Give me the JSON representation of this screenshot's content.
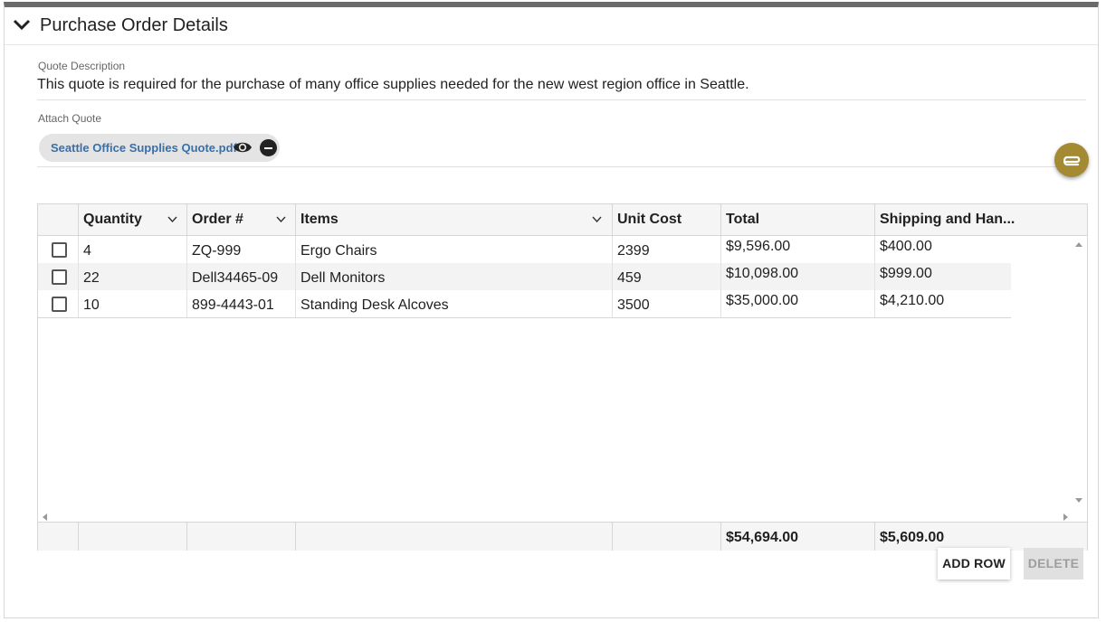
{
  "section": {
    "title": "Purchase Order Details"
  },
  "quote_description": {
    "label": "Quote Description",
    "value": "This quote is required for the purchase of many office supplies needed for the new west region office in Seattle."
  },
  "attach_quote": {
    "label": "Attach Quote",
    "file_name": "Seattle Office Supplies Quote.pdf"
  },
  "grid": {
    "columns": [
      "",
      "Quantity",
      "Order #",
      "Items",
      "Unit Cost",
      "Total",
      "Shipping and Han..."
    ],
    "rows": [
      {
        "quantity": "4",
        "order": "ZQ-999",
        "item": "Ergo Chairs",
        "unit_cost": "2399",
        "total": "$9,596.00",
        "shipping": "$400.00"
      },
      {
        "quantity": "22",
        "order": "Dell34465-09",
        "item": "Dell Monitors",
        "unit_cost": "459",
        "total": "$10,098.00",
        "shipping": "$999.00"
      },
      {
        "quantity": "10",
        "order": "899-4443-01",
        "item": "Standing Desk Alcoves",
        "unit_cost": "3500",
        "total": "$35,000.00",
        "shipping": "$4,210.00"
      }
    ],
    "footer": {
      "total": "$54,694.00",
      "shipping": "$5,609.00"
    }
  },
  "buttons": {
    "add_row": "ADD ROW",
    "delete": "DELETE"
  },
  "colors": {
    "accent": "#a48a32",
    "link": "#3a6fa8",
    "header_bar": "#6b6b6b"
  },
  "icons": [
    "chevron-down-icon",
    "eye-icon",
    "minus-circle-icon",
    "paperclip-icon",
    "sort-chevron-icon"
  ]
}
